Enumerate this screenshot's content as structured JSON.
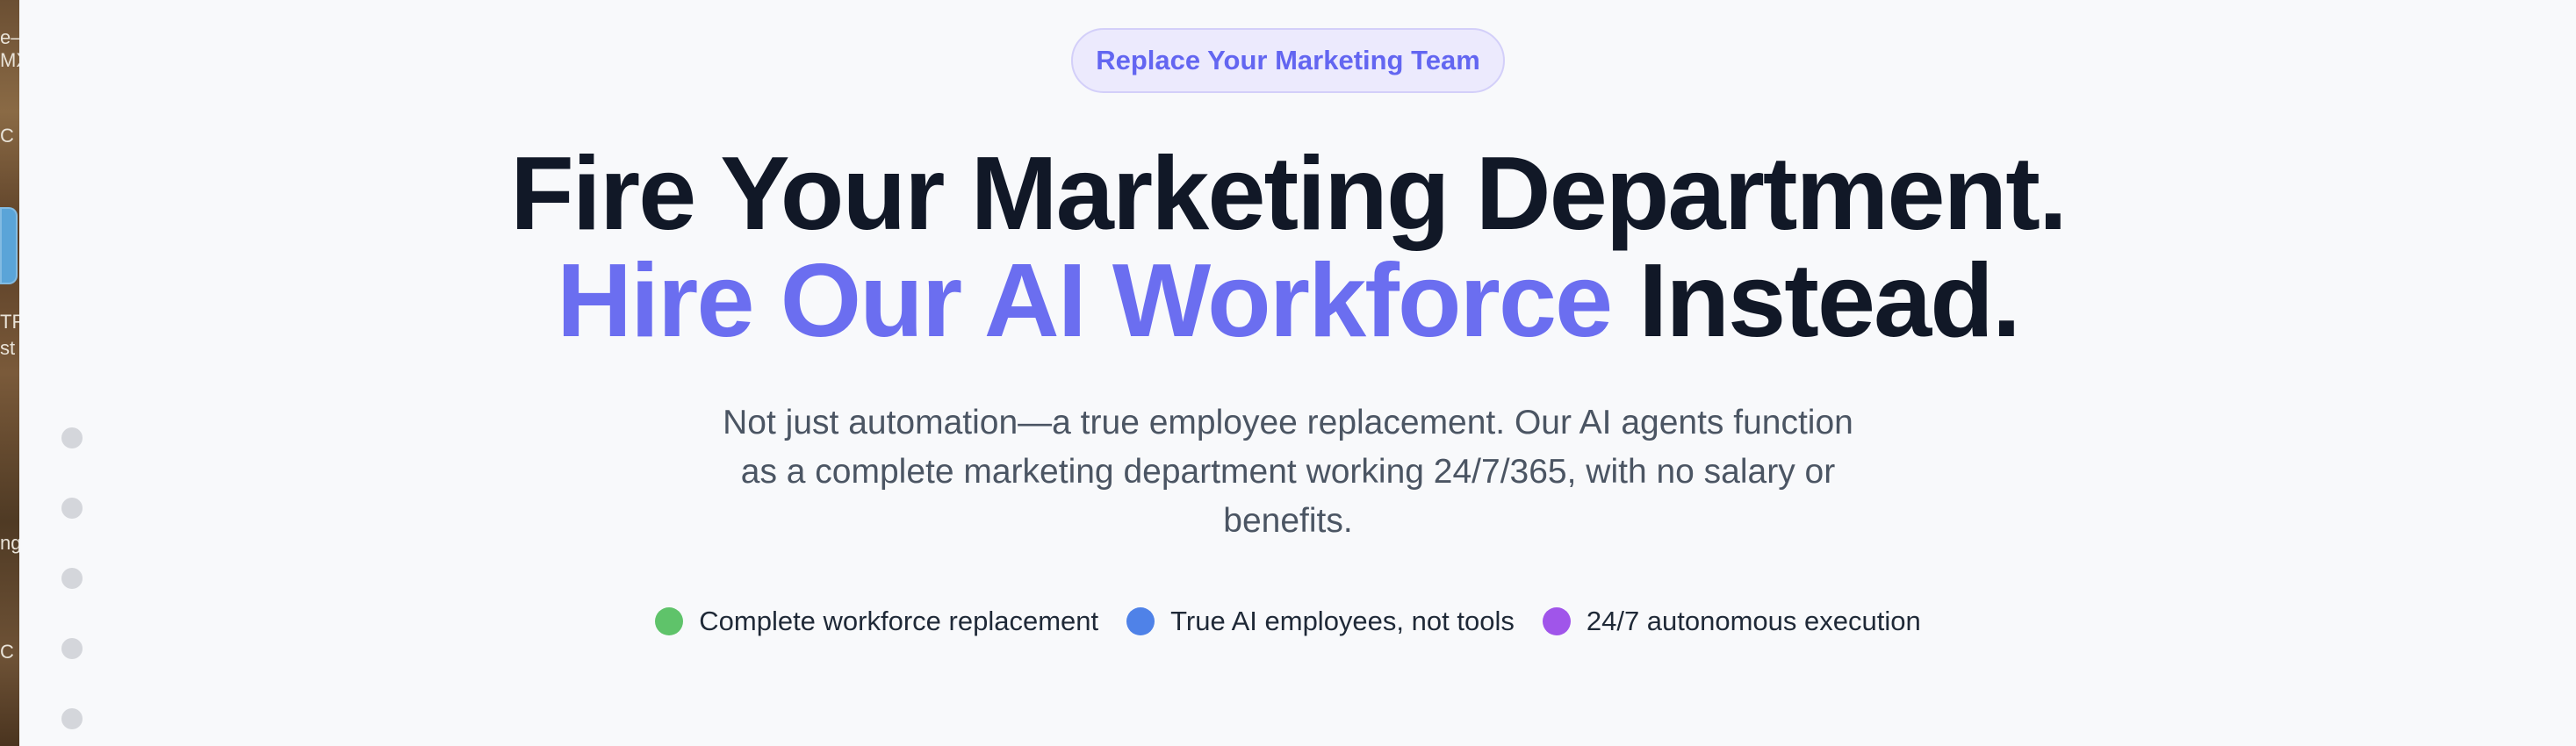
{
  "badge": {
    "label": "Replace Your Marketing Team"
  },
  "headline": {
    "line1": "Fire Your Marketing Department.",
    "line2_accent": "Hire Our AI Workforce",
    "line2_rest": " Instead."
  },
  "subtitle": "Not just automation—a true employee replacement. Our AI agents function as a complete marketing department working 24/7/365, with no salary or benefits.",
  "features": [
    {
      "label": "Complete workforce replacement",
      "color": "#5fc36a"
    },
    {
      "label": "True AI employees, not tools",
      "color": "#4f82e8"
    },
    {
      "label": "24/7 autonomous execution",
      "color": "#a055ea"
    }
  ],
  "edge": {
    "texts": [
      "e–",
      "MX",
      "C",
      "TR",
      "st",
      "ng",
      "C"
    ]
  },
  "colors": {
    "accent": "#6b6ef0",
    "headline": "#111827",
    "background": "#f8f9fb"
  },
  "pagination": {
    "count": 5
  }
}
